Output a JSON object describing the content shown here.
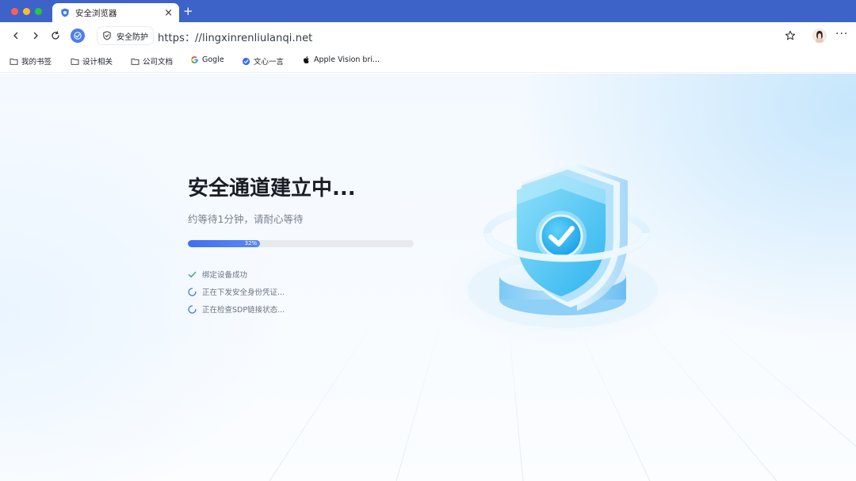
{
  "browser": {
    "tab": {
      "title": "安全浏览器"
    },
    "address_bar": {
      "security_label": "安全防护",
      "url": "https://lingxinrenliulanqi.net",
      "url_display": "https：//lingxinrenliulanqi.net"
    }
  },
  "bookmarks": [
    {
      "label": "我的书签",
      "icon": "folder-icon"
    },
    {
      "label": "设计相关",
      "icon": "folder-icon"
    },
    {
      "label": "公司文档",
      "icon": "folder-icon"
    },
    {
      "label": "Gogle",
      "icon": "google-icon"
    },
    {
      "label": "文心一言",
      "icon": "wenxin-icon"
    },
    {
      "label": "Apple Vision bri...",
      "icon": "apple-icon"
    }
  ],
  "page": {
    "title": "安全通道建立中...",
    "subtitle": "约等待1分钟，请耐心等待",
    "progress": {
      "percent": 32,
      "label": "32%"
    },
    "steps": [
      {
        "text": "绑定设备成功",
        "status": "done"
      },
      {
        "text": "正在下发安全身份凭证...",
        "status": "loading"
      },
      {
        "text": "正在检查SDP链接状态...",
        "status": "loading"
      }
    ]
  },
  "colors": {
    "titlebar": "#3d63c9",
    "accent": "#3f6ff0",
    "success": "#3bb07a"
  }
}
